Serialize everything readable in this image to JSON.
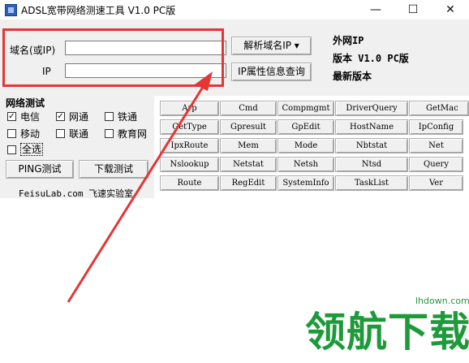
{
  "window": {
    "title": "ADSL宽带网络测速工具 V1.0 PC版",
    "minimize": "—",
    "maximize": "☐",
    "close": "✕"
  },
  "domain_field": {
    "label": "域名(或IP)",
    "value": ""
  },
  "ip_field": {
    "label": "IP",
    "value": ""
  },
  "buttons": {
    "resolve": "解析域名IP ▾",
    "ip_query": "IP属性信息查询",
    "ping": "PING测试",
    "download": "下载测试"
  },
  "info": {
    "external_ip": "外网IP",
    "version": "版本 V1.0 PC版",
    "latest": "最新版本"
  },
  "network_test": {
    "title": "网络测试",
    "options": [
      {
        "label": "电信",
        "checked": true
      },
      {
        "label": "网通",
        "checked": true
      },
      {
        "label": "铁通",
        "checked": false
      },
      {
        "label": "移动",
        "checked": false
      },
      {
        "label": "联通",
        "checked": false
      },
      {
        "label": "教育网",
        "checked": false
      }
    ],
    "select_all": {
      "label": "全选",
      "checked": false
    }
  },
  "footer": "FeisuLab.com 飞速实验室",
  "commands": [
    [
      "Arp",
      "Cmd",
      "Compmgmt",
      "DriverQuery",
      "GetMac"
    ],
    [
      "GetType",
      "Gpresult",
      "GpEdit",
      "HostName",
      "IpConfig"
    ],
    [
      "IpxRoute",
      "Mem",
      "Mode",
      "Nbtstat",
      "Net"
    ],
    [
      "Nslookup",
      "Netstat",
      "Netsh",
      "Ntsd",
      "Query"
    ],
    [
      "Route",
      "RegEdit",
      "SystemInfo",
      "TaskList",
      "Ver"
    ]
  ],
  "watermark": {
    "text": "领航下载",
    "url": "lhdown.com"
  },
  "colors": {
    "highlight": "#e53535",
    "watermark": "#1e9a3a",
    "panel": "#f0f0f0"
  }
}
